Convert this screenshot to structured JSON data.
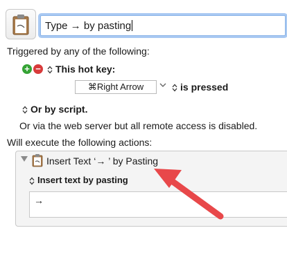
{
  "macro": {
    "title_value": "Type → by pasting",
    "icon": "clipboard-icon"
  },
  "triggers": {
    "heading": "Triggered by any of the following:",
    "add_icon": "plus-icon",
    "remove_icon": "minus-icon",
    "hotkey_label": "This hot key:",
    "hotkey_value": "⌘Right Arrow",
    "hotkey_state": "is pressed",
    "script_label": "Or by script.",
    "web_server_note": "Or via the web server but all remote access is disabled."
  },
  "actions": {
    "heading": "Will execute the following actions:",
    "action_title": "Insert Text ‘→ ’ by Pasting",
    "mode_label": "Insert text by pasting",
    "text_value": "→"
  },
  "annotation": {
    "arrow_color": "#e8484a"
  }
}
